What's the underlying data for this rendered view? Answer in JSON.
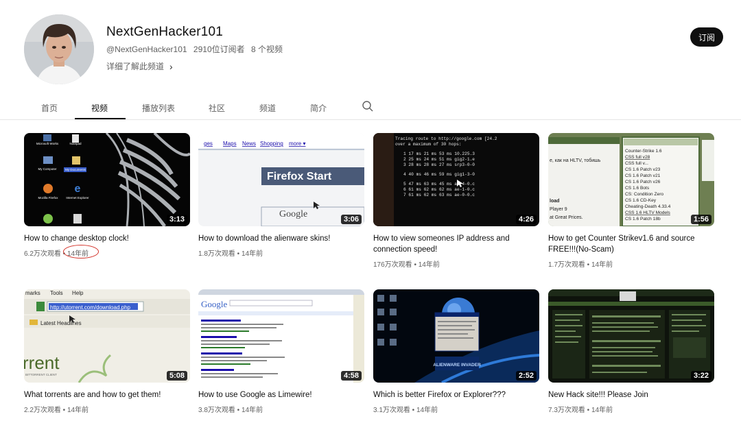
{
  "channel": {
    "name": "NextGenHacker101",
    "handle": "@NextGenHacker101",
    "subscribers": "2910位订阅者",
    "video_count": "8 个视频",
    "about_label": "详细了解此频道",
    "subscribe_label": "订阅"
  },
  "tabs": [
    {
      "label": "首页"
    },
    {
      "label": "视频",
      "active": true
    },
    {
      "label": "播放列表"
    },
    {
      "label": "社区"
    },
    {
      "label": "频道"
    },
    {
      "label": "简介"
    }
  ],
  "videos": [
    {
      "title": "How to change desktop clock!",
      "views": "6.2万次观看",
      "age": "14年前",
      "duration": "3:13",
      "age_circled": true
    },
    {
      "title": "How to download the alienware skins!",
      "views": "1.8万次观看",
      "age": "14年前",
      "duration": "3:06"
    },
    {
      "title": "How to view someones IP address and connection speed!",
      "views": "176万次观看",
      "age": "14年前",
      "duration": "4:26"
    },
    {
      "title": "How to get Counter Strikev1.6 and source FREE!!!(No-Scam)",
      "views": "1.7万次观看",
      "age": "14年前",
      "duration": "1:56"
    },
    {
      "title": "What torrents are and how to get them!",
      "views": "2.2万次观看",
      "age": "14年前",
      "duration": "5:08"
    },
    {
      "title": "How to use Google as Limewire!",
      "views": "3.8万次观看",
      "age": "14年前",
      "duration": "4:58"
    },
    {
      "title": "Which is better Firefox or Explorer???",
      "views": "3.1万次观看",
      "age": "14年前",
      "duration": "2:52"
    },
    {
      "title": "New Hack site!!! Please Join",
      "views": "7.3万次观看",
      "age": "14年前",
      "duration": "3:22"
    }
  ],
  "thumbnail_text": {
    "t1": {
      "icons": [
        "Microsoft Works",
        "Notepad",
        "My Computer",
        "My Documents",
        "Mozilla Firefox",
        "Internet Explorer"
      ]
    },
    "t2": {
      "links": [
        "ges",
        "Maps",
        "News",
        "Shopping",
        "more ▾"
      ],
      "heading": "Firefox Start",
      "logo": "Google"
    },
    "t3": {
      "lines": [
        "Tracing route to http://google.com [24.2",
        "over a maximum of 30 hops:",
        "1  17 ms  21 ms  53 ms  10.225.3",
        "2  25 ms  24 ms  51 ms  gig2-1.e",
        "3  28 ms  28 ms  27 ms  srp3-0-0",
        "4  40 ms  46 ms  59 ms  gig1-3-0",
        "5  47 ms  63 ms  45 ms  ae-4-0.c",
        "6  61 ms  62 ms  62 ms  ae-1-0.c",
        "7  61 ms  62 ms  63 ms  ae-0-0.c"
      ]
    },
    "t4": {
      "items": [
        "Counter-Strike 1.6",
        "CSS full v28",
        "CSS full v...",
        "CS 1.6 Patch v23",
        "CS 1.6 Patch v21",
        "CS 1.6 Patch v26",
        "CS 1.6 Bots",
        "CS: Condition Zero",
        "CS 1.6 CD-Key",
        "Cheating-Death 4.33.4",
        "CSS 1.6 HLTV Models",
        "CS 1.6 Patch 18b"
      ],
      "left_text": [
        "e, как на HLTV, тобишь",
        "load",
        "Player 9",
        "at Great Prices."
      ]
    },
    "t5": {
      "menu": [
        "marks",
        "Tools",
        "Help"
      ],
      "url": "http://utorrent.com/download.php",
      "headline": "Latest Headlines",
      "logo": "rrent",
      "tagline": "BITTORRENT CLIENT"
    },
    "t6": {
      "logo": "Google"
    },
    "t7": {
      "logo": "ALIENWARE INVADER"
    }
  }
}
